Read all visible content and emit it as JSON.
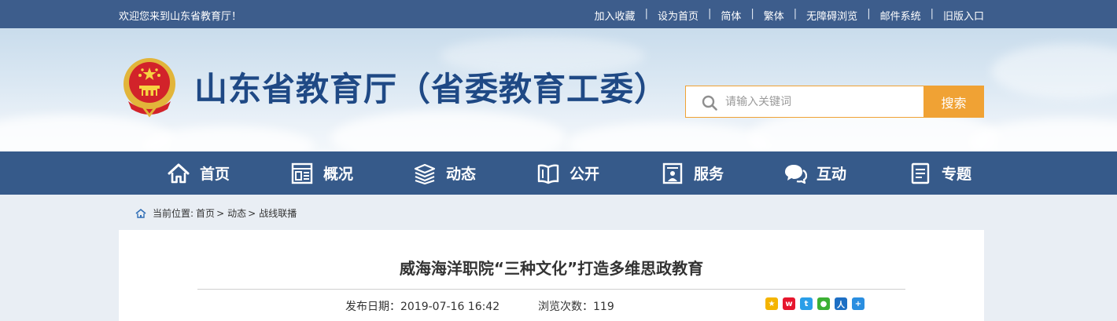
{
  "topbar": {
    "welcome": "欢迎您来到山东省教育厅！",
    "links": [
      "加入收藏",
      "设为首页",
      "简体",
      "繁体",
      "无障碍浏览",
      "邮件系统",
      "旧版入口"
    ],
    "separator": "|"
  },
  "header": {
    "site_title": "山东省教育厅（省委教育工委）",
    "search_placeholder": "请输入关键词",
    "search_button": "搜索"
  },
  "nav": {
    "items": [
      {
        "label": "首页",
        "icon": "home-icon"
      },
      {
        "label": "概况",
        "icon": "overview-icon"
      },
      {
        "label": "动态",
        "icon": "news-stack-icon"
      },
      {
        "label": "公开",
        "icon": "open-book-icon"
      },
      {
        "label": "服务",
        "icon": "service-icon"
      },
      {
        "label": "互动",
        "icon": "chat-icon"
      },
      {
        "label": "专题",
        "icon": "topic-doc-icon"
      }
    ]
  },
  "breadcrumb": {
    "prefix": "当前位置:",
    "items": [
      "首页",
      "动态",
      "战线联播"
    ],
    "separator": ">"
  },
  "article": {
    "title": "威海海洋职院“三种文化”打造多维思政教育",
    "publish_label": "发布日期：",
    "publish_date": "2019-07-16 16:42",
    "views_label": "浏览次数：",
    "views": "119"
  },
  "colors": {
    "topbar": "#3d5d8c",
    "nav": "#365a8a",
    "title": "#1f4985",
    "accent": "#f0a234"
  },
  "share_icons": [
    "qzone-icon",
    "weibo-icon",
    "tencent-weibo-icon",
    "wechat-icon",
    "renren-icon",
    "more-share-icon"
  ]
}
